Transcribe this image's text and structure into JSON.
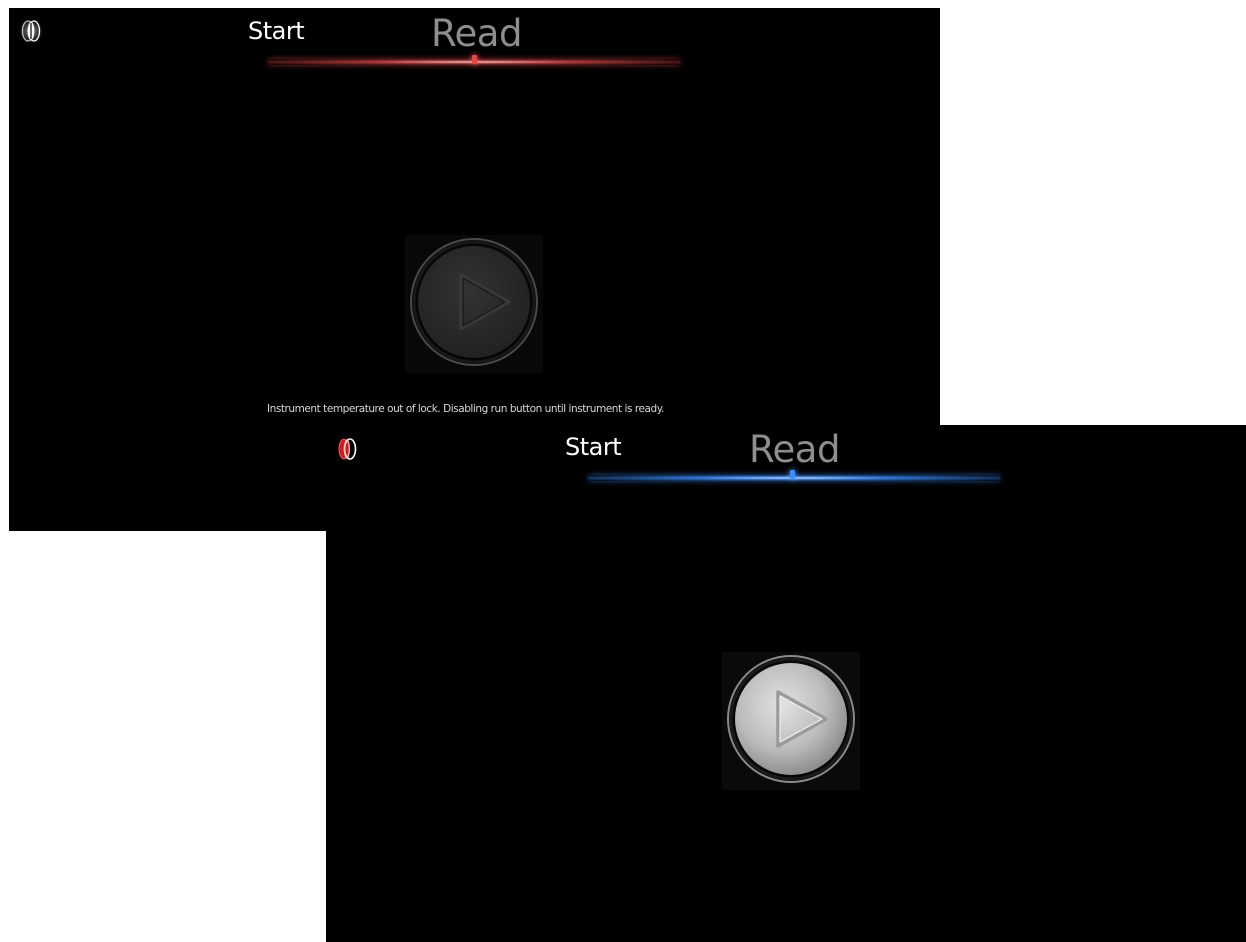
{
  "screens": [
    {
      "id": "disabled",
      "nav": {
        "start_label": "Start",
        "read_label": "Read"
      },
      "indicator_color": "#e04848",
      "logo_accent": "#ffffff",
      "run_button_state": "disabled",
      "status_message": "Instrument temperature out of lock. Disabling run button until instrument is ready."
    },
    {
      "id": "ready",
      "nav": {
        "start_label": "Start",
        "read_label": "Read"
      },
      "indicator_color": "#3a8cff",
      "logo_accent": "#d81818",
      "run_button_state": "enabled"
    }
  ],
  "icons": {
    "logo": "logo-icon",
    "run": "play-icon"
  },
  "colors": {
    "background": "#000000",
    "disabled_button": "#2a2a2a",
    "enabled_button": "#c8c8c8",
    "red_glow": "#e04848",
    "blue_glow": "#3a8cff"
  }
}
